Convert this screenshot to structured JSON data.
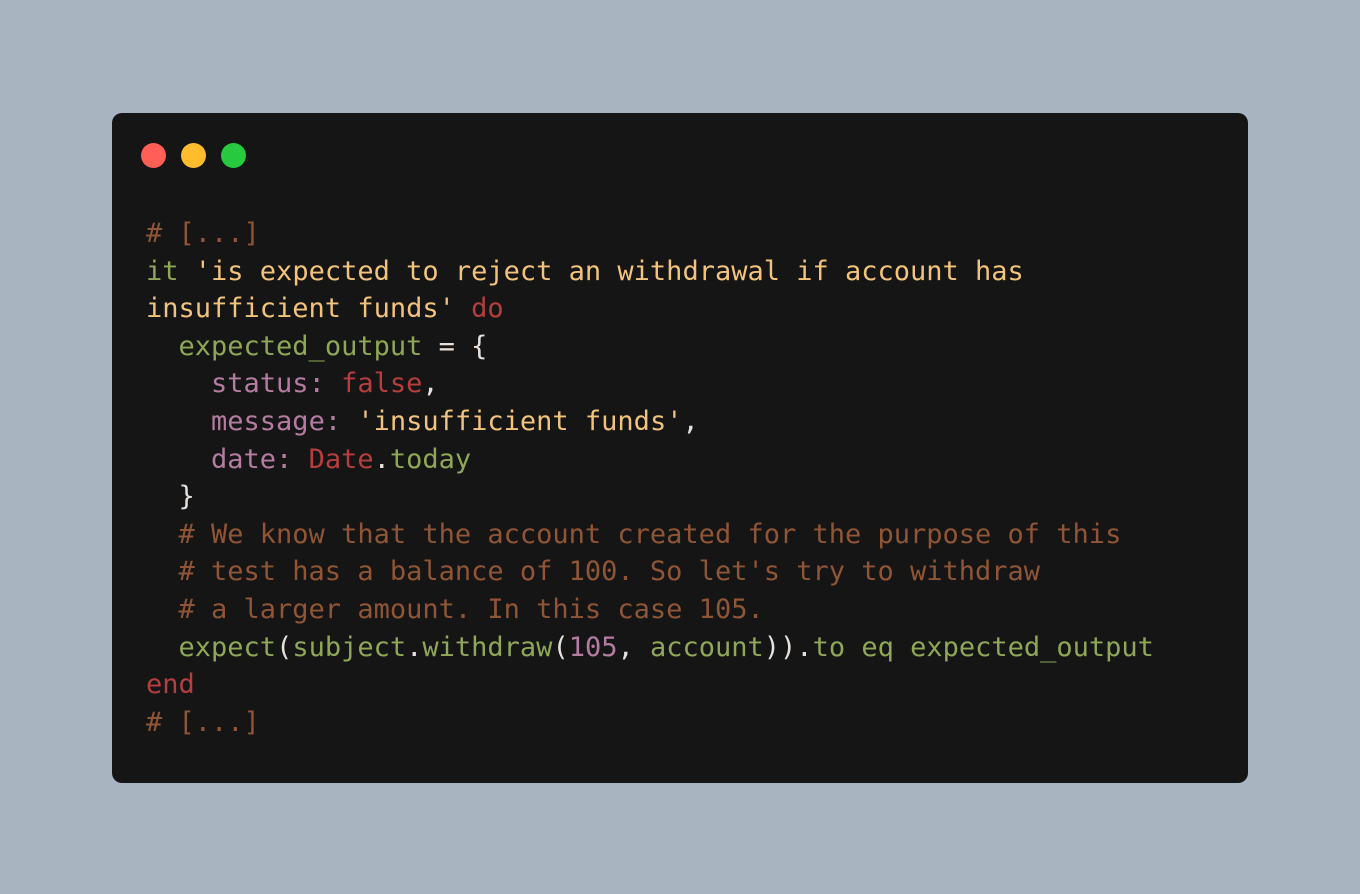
{
  "window": {
    "controls": [
      {
        "name": "close",
        "color": "#ff5f56"
      },
      {
        "name": "minimize",
        "color": "#ffbd2e"
      },
      {
        "name": "zoom",
        "color": "#27c93f"
      }
    ]
  },
  "colors": {
    "background": "#a8b4c0",
    "window_bg": "#151515",
    "comment": "#8f5536",
    "string": "#f2c37c",
    "keyword": "#b53e3e",
    "identifier": "#8fa757",
    "symbol": "#b57ca1",
    "plain": "#e6e1dc"
  },
  "code": {
    "lines": [
      [
        {
          "t": "# [...]",
          "k": "comment"
        }
      ],
      [
        {
          "t": "it ",
          "k": "identifier"
        },
        {
          "t": "'is expected to reject an withdrawal if account has",
          "k": "string"
        }
      ],
      [
        {
          "t": "insufficient funds'",
          "k": "string"
        },
        {
          "t": " ",
          "k": "plain"
        },
        {
          "t": "do",
          "k": "keyword"
        }
      ],
      [
        {
          "t": "  ",
          "k": "plain"
        },
        {
          "t": "expected_output",
          "k": "identifier"
        },
        {
          "t": " = {",
          "k": "plain"
        }
      ],
      [
        {
          "t": "    ",
          "k": "plain"
        },
        {
          "t": "status:",
          "k": "symbol"
        },
        {
          "t": " ",
          "k": "plain"
        },
        {
          "t": "false",
          "k": "keyword"
        },
        {
          "t": ",",
          "k": "plain"
        }
      ],
      [
        {
          "t": "    ",
          "k": "plain"
        },
        {
          "t": "message:",
          "k": "symbol"
        },
        {
          "t": " ",
          "k": "plain"
        },
        {
          "t": "'insufficient funds'",
          "k": "string"
        },
        {
          "t": ",",
          "k": "plain"
        }
      ],
      [
        {
          "t": "    ",
          "k": "plain"
        },
        {
          "t": "date:",
          "k": "symbol"
        },
        {
          "t": " ",
          "k": "plain"
        },
        {
          "t": "Date",
          "k": "keyword"
        },
        {
          "t": ".",
          "k": "plain"
        },
        {
          "t": "today",
          "k": "identifier"
        }
      ],
      [
        {
          "t": "  }",
          "k": "plain"
        }
      ],
      [
        {
          "t": "  # We know that the account created for the purpose of this",
          "k": "comment"
        }
      ],
      [
        {
          "t": "  # test has a balance of 100. So let's try to withdraw",
          "k": "comment"
        }
      ],
      [
        {
          "t": "  # a larger amount. In this case 105.",
          "k": "comment"
        }
      ],
      [
        {
          "t": "  ",
          "k": "plain"
        },
        {
          "t": "expect",
          "k": "identifier"
        },
        {
          "t": "(",
          "k": "plain"
        },
        {
          "t": "subject",
          "k": "identifier"
        },
        {
          "t": ".",
          "k": "plain"
        },
        {
          "t": "withdraw",
          "k": "identifier"
        },
        {
          "t": "(",
          "k": "plain"
        },
        {
          "t": "105",
          "k": "symbol"
        },
        {
          "t": ", ",
          "k": "plain"
        },
        {
          "t": "account",
          "k": "identifier"
        },
        {
          "t": ")).",
          "k": "plain"
        },
        {
          "t": "to eq expected_output",
          "k": "identifier"
        }
      ],
      [
        {
          "t": "end",
          "k": "keyword"
        }
      ],
      [
        {
          "t": "# [...]",
          "k": "comment"
        }
      ]
    ]
  }
}
